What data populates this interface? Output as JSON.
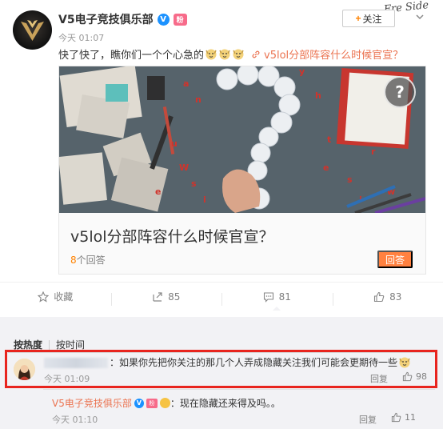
{
  "post": {
    "author": "V5电子竞技俱乐部",
    "verified_badge": "V",
    "medal_badge": "粉",
    "time": "今天 01:07",
    "follow_label": "关注",
    "follow_plus": "+",
    "watermark": "Fre Side",
    "text": "快了快了，瞧你们一个个心急的",
    "emoji_count": 3,
    "link_icon": "link-icon",
    "link_text": "v5lol分部阵容什么时候官宣？"
  },
  "card": {
    "question_mark": "?",
    "title": "v5lol分部阵容什么时候官宣？",
    "answers_count": "8",
    "answers_suffix": "个回答",
    "answer_button": "回答"
  },
  "actions": [
    {
      "icon": "star-icon",
      "label": "收藏"
    },
    {
      "icon": "share-icon",
      "label": "85"
    },
    {
      "icon": "comment-icon",
      "label": "81"
    },
    {
      "icon": "thumbs-up-icon",
      "label": "83"
    }
  ],
  "comments": {
    "sort_hot": "按热度",
    "sort_time": "按时间",
    "items": [
      {
        "text": "：如果你先把你关注的那几个人弄成隐藏关注我们可能会更期待一些",
        "time": "今天 01:09",
        "reply_label": "回复",
        "likes": "98"
      }
    ],
    "reply": {
      "author": "V5电子竞技俱乐部",
      "verified_badge": "V",
      "text": "：现在隐藏还来得及吗。。",
      "time": "今天 01:10",
      "reply_label": "回复",
      "likes": "11"
    }
  },
  "colors": {
    "accent": "#ff8200",
    "link": "#eb7350",
    "verified": "#1c92ff",
    "highlight_border": "#e8241e",
    "comment_bg": "#f2f2f5"
  }
}
